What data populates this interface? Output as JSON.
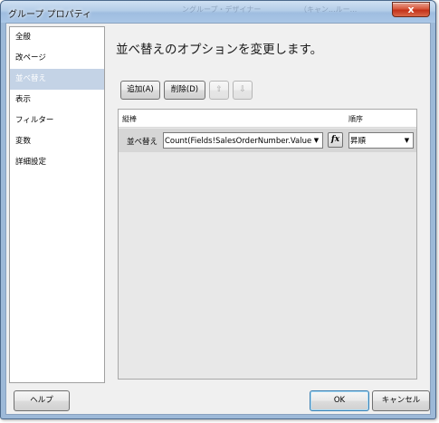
{
  "window": {
    "title": "グループ プロパティ",
    "close_label": "x",
    "background_text": [
      "ングループ・デザイナー",
      "（キャン...ルー..."
    ]
  },
  "sidebar": {
    "items": [
      {
        "label": "全般"
      },
      {
        "label": "改ページ"
      },
      {
        "label": "並べ替え",
        "selected": true
      },
      {
        "label": "表示"
      },
      {
        "label": "フィルター"
      },
      {
        "label": "変数"
      },
      {
        "label": "詳細設定"
      }
    ]
  },
  "main": {
    "heading": "並べ替えのオプションを変更します。",
    "toolbar": {
      "add_label": "追加(A)",
      "delete_label": "削除(D)",
      "move_up_icon": "up-arrow-icon",
      "move_down_icon": "down-arrow-icon"
    },
    "grid": {
      "columns": {
        "sort_by": "縦棒",
        "order": "順序"
      },
      "rows": [
        {
          "label": "並べ替え",
          "expression": "Count(Fields!SalesOrderNumber.Value)",
          "fx_label": "fx",
          "order": "昇順"
        }
      ]
    }
  },
  "footer": {
    "help_label": "ヘルプ",
    "ok_label": "OK",
    "cancel_label": "キャンセル"
  },
  "colors": {
    "selected_nav": "#c4d3e6",
    "frame": "#9db9d8",
    "close_button": "#c3321a"
  }
}
